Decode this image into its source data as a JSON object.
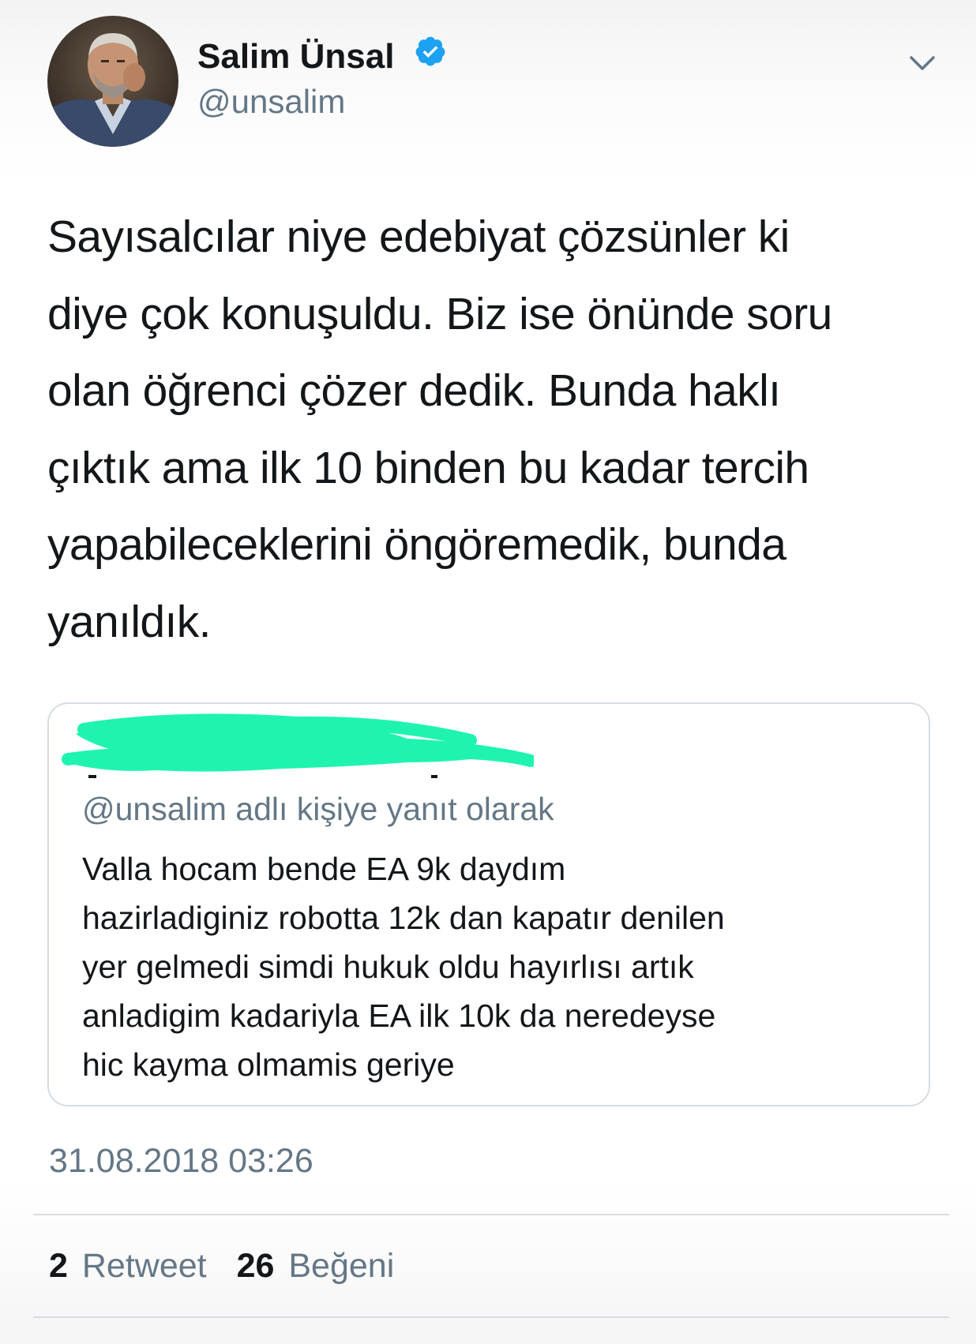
{
  "author": {
    "name": "Salim Ünsal",
    "handle": "@unsalim",
    "verified_color": "#1da1f2"
  },
  "menu": {
    "icon": "chevron-down-icon"
  },
  "tweet": {
    "text_lines": [
      "Sayısalcılar niye edebiyat çözsünler ki",
      "diye çok konuşuldu. Biz ise önünde soru",
      "olan öğrenci çözer dedik. Bunda haklı",
      "çıktık ama ilk 10 binden bu kadar tercih",
      "yapabileceklerini öngöremedik, bunda",
      "yanıldık."
    ],
    "timestamp": "31.08.2018 03:26"
  },
  "quoted_tweet": {
    "redaction_color": "#1ef4b0",
    "reply_to": "@unsalim adlı kişiye yanıt olarak",
    "body_lines": [
      "Valla hocam bende EA 9k daydım",
      "hazirladiginiz robotta 12k dan kapatır denilen",
      "yer gelmedi simdi hukuk oldu hayırlısı artık",
      "anladigim kadariyla EA ilk 10k da neredeyse",
      "hic kayma olmamis geriye"
    ]
  },
  "stats": {
    "retweets": {
      "count": "2",
      "label": "Retweet"
    },
    "likes": {
      "count": "26",
      "label": "Beğeni"
    }
  },
  "colors": {
    "text": "#14171a",
    "secondary": "#657786",
    "divider": "#d9dde1"
  }
}
